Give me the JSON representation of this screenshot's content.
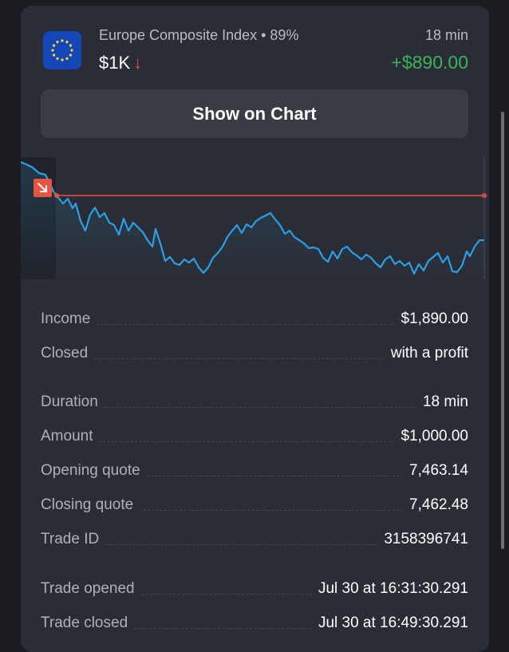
{
  "header": {
    "asset_name": "Europe Composite Index • 89%",
    "amount": "$1K",
    "direction_arrow": "↓",
    "duration": "18 min",
    "profit": "+$890.00"
  },
  "show_chart_button": "Show on Chart",
  "details": [
    {
      "label": "Income",
      "value": "$1,890.00"
    },
    {
      "label": "Closed",
      "value": "with a profit"
    },
    {
      "label": "Duration",
      "value": "18 min"
    },
    {
      "label": "Amount",
      "value": "$1,000.00"
    },
    {
      "label": "Opening quote",
      "value": "7,463.14"
    },
    {
      "label": "Closing quote",
      "value": "7,462.48"
    },
    {
      "label": "Trade ID",
      "value": "3158396741"
    },
    {
      "label": "Trade opened",
      "value": "Jul 30 at 16:31:30.291"
    },
    {
      "label": "Trade closed",
      "value": "Jul 30 at 16:49:30.291"
    }
  ],
  "colors": {
    "panel": "#2a2d35",
    "profit": "#3db25b",
    "down_arrow": "#ef4b3c",
    "line": "#2b9fe6",
    "open_level": "#e8543f",
    "asset_icon": "#1546b8"
  },
  "icons": {
    "asset": "eu-flag-icon",
    "direction": "arrow-down-icon",
    "entry_marker": "arrow-down-right-icon"
  }
}
